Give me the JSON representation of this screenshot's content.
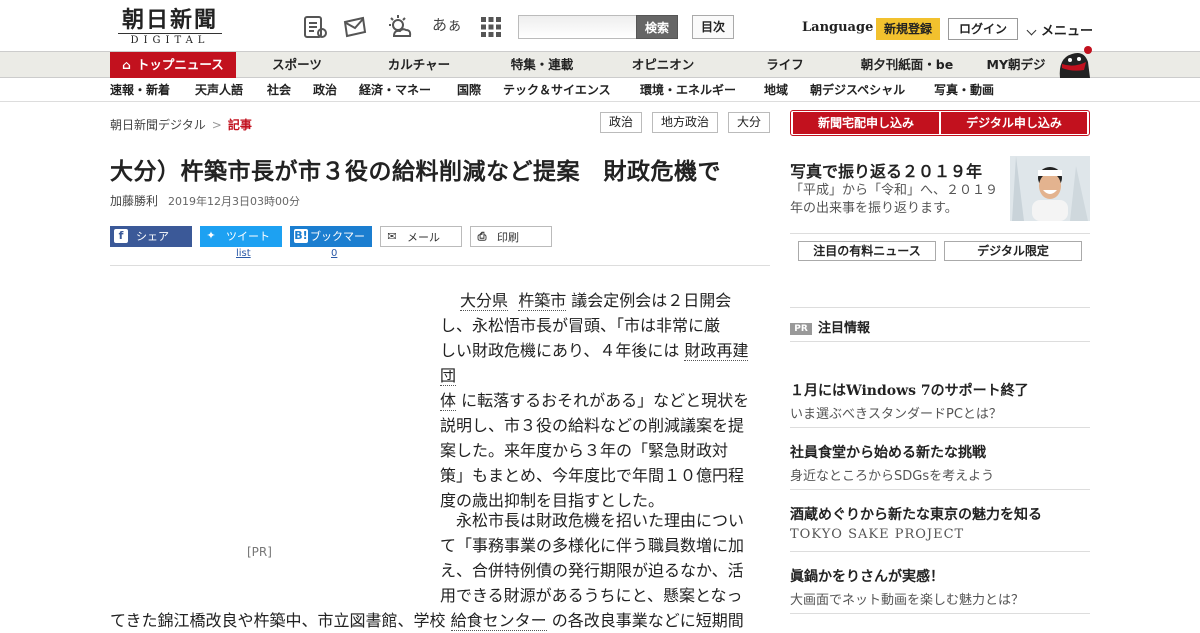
{
  "header": {
    "logo_line1": "朝日新聞",
    "logo_line2": "DIGITAL",
    "icon_kana": "あぁ",
    "search_button": "検索",
    "toc_button": "目次",
    "language": "Language",
    "register": "新規登録",
    "login": "ログイン",
    "menu": "メニュー"
  },
  "nav_main": [
    "トップニュース",
    "スポーツ",
    "カルチャー",
    "特集・連載",
    "オピニオン",
    "ライフ",
    "朝夕刊紙面・be",
    "MY朝デジ"
  ],
  "nav_sub": [
    "速報・新着",
    "天声人語",
    "社会",
    "政治",
    "経済・マネー",
    "国際",
    "テック＆サイエンス",
    "環境・エネルギー",
    "地域",
    "朝デジスペシャル",
    "写真・動画"
  ],
  "breadcrumb": {
    "home": "朝日新聞デジタル",
    "sep": ">",
    "current": "記事"
  },
  "tags": [
    "政治",
    "地方政治",
    "大分"
  ],
  "article": {
    "title": "大分）杵築市長が市３役の給料削減など提案　財政危機で",
    "author": "加藤勝利",
    "date": "2019年12月3日03時00分",
    "pr_label": "[PR]",
    "p1_l1a": "大分県",
    "p1_l1b": "杵築市",
    "p1_l1c": "議会定例会は２日開会",
    "p1_l2": "し、永松悟市長が冒頭、「市は非常に厳",
    "p1_l3a": "しい財政危機にあり、４年後には",
    "p1_l3b": "財政再建団",
    "p1_l4a": "体",
    "p1_l4b": "に転落するおそれがある」などと現状を",
    "p1_l5": "説明し、市３役の給料などの削減議案を提",
    "p1_l6": "案した。来年度から３年の「緊急財政対",
    "p1_l7": "策」もまとめ、今年度比で年間１０億円程",
    "p1_l8": "度の歳出抑制を目指すとした。",
    "p2_l1": "永松市長は財政危機を招いた理由につい",
    "p2_l2": "て「事務事業の多様化に伴う職員数増に加",
    "p2_l3": "え、合併特例債の発行期限が迫るなか、活",
    "p2_l4": "用できる財源があるうちにと、懸案となっ",
    "p2_l5a": "てきた錦江橋改良や杵築中、市立図書館、学校",
    "p2_l5b": "給食センター",
    "p2_l5c": "の各改良事業などに短期間"
  },
  "share": {
    "facebook": "シェア",
    "twitter": "ツイート",
    "twitter_count": "list",
    "hatena": "ブックマーク",
    "hatena_count": "0",
    "mail": "メール",
    "print": "印刷"
  },
  "sidebar": {
    "btn_paper": "新聞宅配申し込み",
    "btn_digital": "デジタル申し込み",
    "photo_title": "写真で振り返る２０１９年",
    "photo_text": "「平成」から「令和」へ、２０１９年の出来事を振り返ります。",
    "tab_paid": "注目の有料ニュース",
    "tab_digital": "デジタル限定",
    "pr_badge": "PR",
    "pr_heading": "注目情報",
    "ads": [
      {
        "title": "１月にはWindows 7のサポート終了",
        "sub": "いま選ぶべきスタンダードPCとは？"
      },
      {
        "title": "社員食堂から始める新たな挑戦",
        "sub": "身近なところからSDGsを考えよう"
      },
      {
        "title": "酒蔵めぐりから新たな東京の魅力を知る",
        "sub": "TOKYO SAKE PROJECT"
      },
      {
        "title": "眞鍋かをりさんが実感！",
        "sub": "大画面でネット動画を楽しむ魅力とは？"
      }
    ]
  },
  "colors": {
    "brand_red": "#c2111e",
    "register_yellow": "#f2c12e",
    "facebook": "#3b5998",
    "twitter": "#1da1f2",
    "hatena": "#1b7ed0"
  }
}
